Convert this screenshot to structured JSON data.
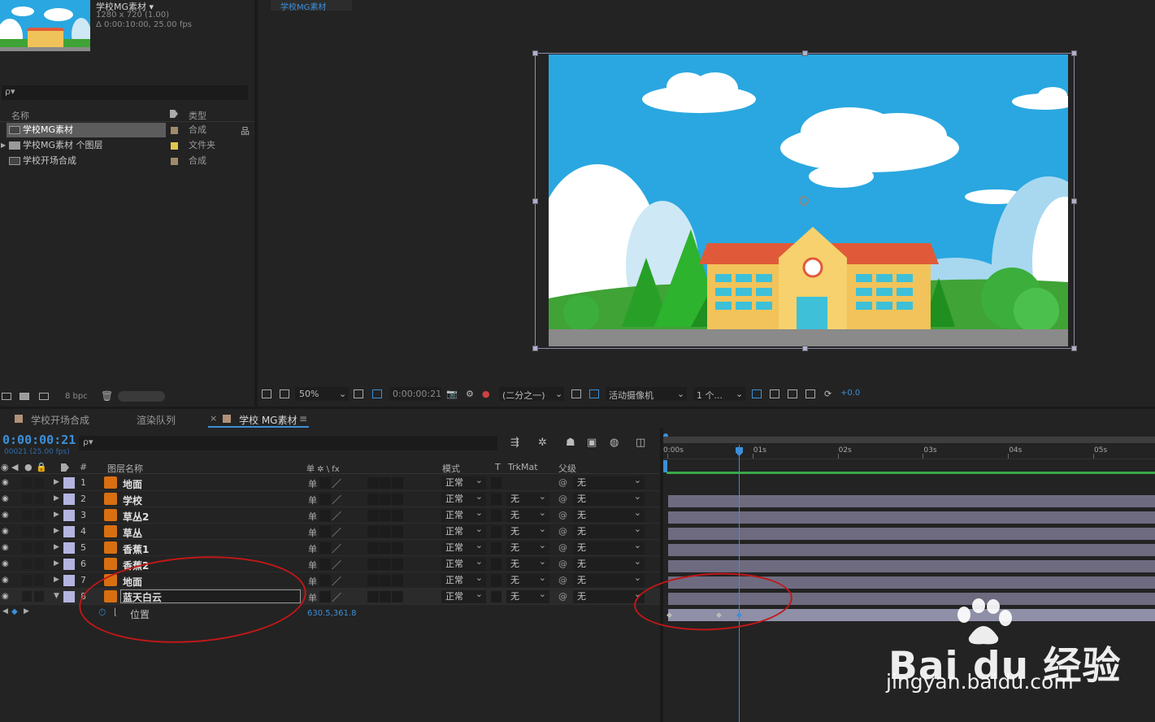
{
  "project": {
    "comp_name": "学校MG素材 ▾",
    "comp_size": "1280 x 720 (1.00)",
    "comp_duration": "Δ 0:00:10:00, 25.00 fps",
    "search_icon": "ρ▾",
    "col_name": "名称",
    "col_type": "类型",
    "items": [
      {
        "name": "学校MG素材",
        "type": "合成",
        "label_color": "#a08a6c",
        "kind": "comp"
      },
      {
        "name": "学校MG素材 个图层",
        "type": "文件夹",
        "label_color": "#e0c84a",
        "kind": "folder"
      },
      {
        "name": "学校开场合成",
        "type": "合成",
        "label_color": "#a08a6c",
        "kind": "comp"
      }
    ],
    "bpc": "8 bpc"
  },
  "viewer": {
    "tab": "学校MG素材",
    "zoom": "50%",
    "timecode": "0:00:00:21",
    "resolution": "(二分之一)",
    "camera": "活动摄像机",
    "views": "1 个...",
    "exposure": "+0.0"
  },
  "timeline": {
    "tabs": [
      {
        "label": "学校开场合成"
      },
      {
        "label": "渲染队列"
      },
      {
        "label": "学校 MG素材"
      }
    ],
    "close_glyph": "×",
    "menu_glyph": "≡",
    "timecode": "0:00:00:21",
    "frames": "00021 (25.00 fps)",
    "search_icon": "ρ▾",
    "headers": {
      "num": "#",
      "layer_name": "图层名称",
      "switches": "单 ✲ \\ fx",
      "mode": "模式",
      "t": "T",
      "trkmat": "TrkMat",
      "parent": "父级"
    },
    "layers": [
      {
        "num": "1",
        "name": "地面",
        "mode": "正常",
        "trkmat": "",
        "parent": "无"
      },
      {
        "num": "2",
        "name": "学校",
        "mode": "正常",
        "trkmat": "无",
        "parent": "无"
      },
      {
        "num": "3",
        "name": "草丛2",
        "mode": "正常",
        "trkmat": "无",
        "parent": "无"
      },
      {
        "num": "4",
        "name": "草丛",
        "mode": "正常",
        "trkmat": "无",
        "parent": "无"
      },
      {
        "num": "5",
        "name": "香蕉1",
        "mode": "正常",
        "trkmat": "无",
        "parent": "无"
      },
      {
        "num": "6",
        "name": "香蕉2",
        "mode": "正常",
        "trkmat": "无",
        "parent": "无"
      },
      {
        "num": "7",
        "name": "地面",
        "mode": "正常",
        "trkmat": "无",
        "parent": "无"
      },
      {
        "num": "8",
        "name": "蓝天白云",
        "mode": "正常",
        "trkmat": "无",
        "parent": "无"
      }
    ],
    "property": {
      "name": "位置",
      "value": "630.5,361.8"
    },
    "ruler": [
      "0:00s",
      "01s",
      "02s",
      "03s",
      "04s",
      "05s"
    ]
  },
  "watermark": {
    "brand": "Bai du 经验",
    "url": "jingyan.baidu.com"
  },
  "colors": {
    "accent": "#3c8fd8",
    "sky": "#2aa7e0",
    "annotation": "#c01818"
  }
}
